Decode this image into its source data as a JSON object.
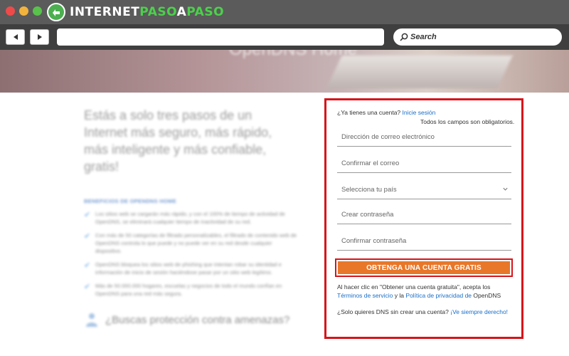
{
  "browser": {
    "logo_text_pre": "INTERNET",
    "logo_text_accent1": "PASO",
    "logo_text_mid": "A",
    "logo_text_accent2": "PASO",
    "search_placeholder": "Search"
  },
  "hero": {
    "title": "OpenDNS Home"
  },
  "left": {
    "heading": "Estás a solo tres pasos de un Internet más seguro, más rápido, más inteligente y más confiable, gratis!",
    "benefits_title": "BENEFICIOS DE OPENDNS HOME",
    "benefits": [
      "Los sitios web se cargarán más rápido, y con el 100% de tiempo de actividad de OpenDNS, se eliminará cualquier tiempo de inactividad de su red.",
      "Con más de 50 categorías de filtrado personalizables, el filtrado de contenido web de OpenDNS controla lo que puede y no puede ver en su red desde cualquier dispositivo.",
      "OpenDNS bloquea los sitios web de phishing que intentan robar su identidad e información de inicio de sesión haciéndose pasar por un sitio web legítimo.",
      "Más de 50.000.000 hogares, escuelas y negocios de todo el mundo confían en OpenDNS para una red más segura."
    ],
    "threats_text": "¿Buscas protección contra amenazas?"
  },
  "signup": {
    "login_question": "¿Ya tienes una cuenta?",
    "login_link": "Inicie sesión",
    "required_note": "Todos los campos son obligatorios.",
    "email_placeholder": "Dirección de correo electrónico",
    "confirm_email_placeholder": "Confirmar el correo",
    "country_placeholder": "Selecciona tu país",
    "password_placeholder": "Crear contraseña",
    "confirm_password_placeholder": "Confirmar contraseña",
    "cta_label": "OBTENGA UNA CUENTA GRATIS",
    "terms_prefix": "Al hacer clic en \"Obtener una cuenta gratuita\", acepta los",
    "terms_link": "Términos de servicio",
    "terms_and": "y la",
    "privacy_link": "Política de privacidad de",
    "terms_suffix": "OpenDNS",
    "dns_question": "¿Solo quieres DNS sin crear una cuenta?",
    "dns_link": "¡Ve siempre derecho!"
  },
  "colors": {
    "highlight_border": "#d6141a",
    "cta_background": "#e8772a",
    "link": "#1a6fc9"
  }
}
